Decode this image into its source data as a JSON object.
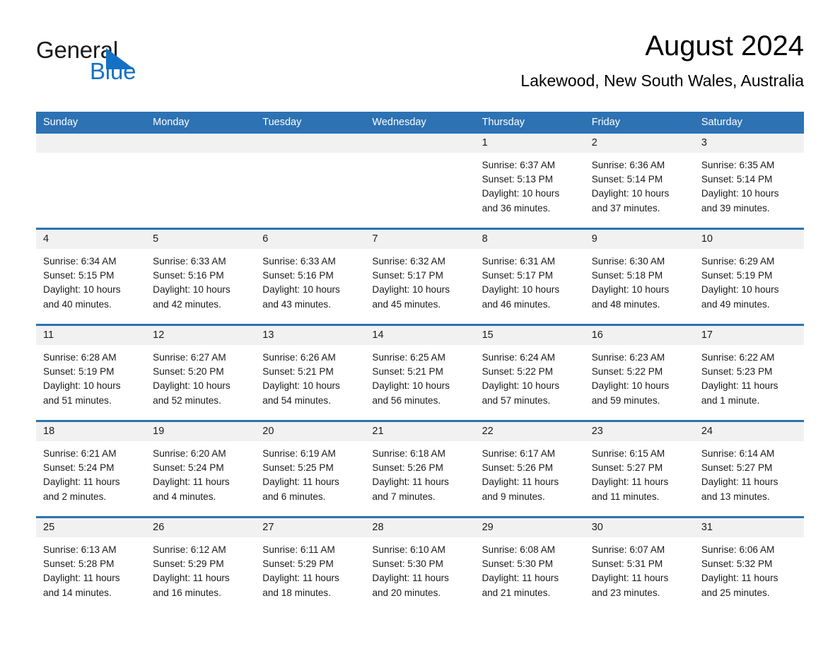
{
  "brand": {
    "name_part1": "General",
    "name_part2": "Blue",
    "triangle_color": "#1571c4",
    "blue_text_color": "#1571c4"
  },
  "header": {
    "month_title": "August 2024",
    "location": "Lakewood, New South Wales, Australia"
  },
  "theme": {
    "header_blue": "#2d72b3",
    "daynum_band": "#f1f1f1",
    "cell_background": "#ffffff",
    "text_color": "#1a1a1a"
  },
  "weekday_headers": [
    "Sunday",
    "Monday",
    "Tuesday",
    "Wednesday",
    "Thursday",
    "Friday",
    "Saturday"
  ],
  "weeks": [
    {
      "cells": [
        {
          "day": "",
          "info": ""
        },
        {
          "day": "",
          "info": ""
        },
        {
          "day": "",
          "info": ""
        },
        {
          "day": "",
          "info": ""
        },
        {
          "day": "1",
          "info": "Sunrise: 6:37 AM\nSunset: 5:13 PM\nDaylight: 10 hours\nand 36 minutes."
        },
        {
          "day": "2",
          "info": "Sunrise: 6:36 AM\nSunset: 5:14 PM\nDaylight: 10 hours\nand 37 minutes."
        },
        {
          "day": "3",
          "info": "Sunrise: 6:35 AM\nSunset: 5:14 PM\nDaylight: 10 hours\nand 39 minutes."
        }
      ]
    },
    {
      "cells": [
        {
          "day": "4",
          "info": "Sunrise: 6:34 AM\nSunset: 5:15 PM\nDaylight: 10 hours\nand 40 minutes."
        },
        {
          "day": "5",
          "info": "Sunrise: 6:33 AM\nSunset: 5:16 PM\nDaylight: 10 hours\nand 42 minutes."
        },
        {
          "day": "6",
          "info": "Sunrise: 6:33 AM\nSunset: 5:16 PM\nDaylight: 10 hours\nand 43 minutes."
        },
        {
          "day": "7",
          "info": "Sunrise: 6:32 AM\nSunset: 5:17 PM\nDaylight: 10 hours\nand 45 minutes."
        },
        {
          "day": "8",
          "info": "Sunrise: 6:31 AM\nSunset: 5:17 PM\nDaylight: 10 hours\nand 46 minutes."
        },
        {
          "day": "9",
          "info": "Sunrise: 6:30 AM\nSunset: 5:18 PM\nDaylight: 10 hours\nand 48 minutes."
        },
        {
          "day": "10",
          "info": "Sunrise: 6:29 AM\nSunset: 5:19 PM\nDaylight: 10 hours\nand 49 minutes."
        }
      ]
    },
    {
      "cells": [
        {
          "day": "11",
          "info": "Sunrise: 6:28 AM\nSunset: 5:19 PM\nDaylight: 10 hours\nand 51 minutes."
        },
        {
          "day": "12",
          "info": "Sunrise: 6:27 AM\nSunset: 5:20 PM\nDaylight: 10 hours\nand 52 minutes."
        },
        {
          "day": "13",
          "info": "Sunrise: 6:26 AM\nSunset: 5:21 PM\nDaylight: 10 hours\nand 54 minutes."
        },
        {
          "day": "14",
          "info": "Sunrise: 6:25 AM\nSunset: 5:21 PM\nDaylight: 10 hours\nand 56 minutes."
        },
        {
          "day": "15",
          "info": "Sunrise: 6:24 AM\nSunset: 5:22 PM\nDaylight: 10 hours\nand 57 minutes."
        },
        {
          "day": "16",
          "info": "Sunrise: 6:23 AM\nSunset: 5:22 PM\nDaylight: 10 hours\nand 59 minutes."
        },
        {
          "day": "17",
          "info": "Sunrise: 6:22 AM\nSunset: 5:23 PM\nDaylight: 11 hours\nand 1 minute."
        }
      ]
    },
    {
      "cells": [
        {
          "day": "18",
          "info": "Sunrise: 6:21 AM\nSunset: 5:24 PM\nDaylight: 11 hours\nand 2 minutes."
        },
        {
          "day": "19",
          "info": "Sunrise: 6:20 AM\nSunset: 5:24 PM\nDaylight: 11 hours\nand 4 minutes."
        },
        {
          "day": "20",
          "info": "Sunrise: 6:19 AM\nSunset: 5:25 PM\nDaylight: 11 hours\nand 6 minutes."
        },
        {
          "day": "21",
          "info": "Sunrise: 6:18 AM\nSunset: 5:26 PM\nDaylight: 11 hours\nand 7 minutes."
        },
        {
          "day": "22",
          "info": "Sunrise: 6:17 AM\nSunset: 5:26 PM\nDaylight: 11 hours\nand 9 minutes."
        },
        {
          "day": "23",
          "info": "Sunrise: 6:15 AM\nSunset: 5:27 PM\nDaylight: 11 hours\nand 11 minutes."
        },
        {
          "day": "24",
          "info": "Sunrise: 6:14 AM\nSunset: 5:27 PM\nDaylight: 11 hours\nand 13 minutes."
        }
      ]
    },
    {
      "cells": [
        {
          "day": "25",
          "info": "Sunrise: 6:13 AM\nSunset: 5:28 PM\nDaylight: 11 hours\nand 14 minutes."
        },
        {
          "day": "26",
          "info": "Sunrise: 6:12 AM\nSunset: 5:29 PM\nDaylight: 11 hours\nand 16 minutes."
        },
        {
          "day": "27",
          "info": "Sunrise: 6:11 AM\nSunset: 5:29 PM\nDaylight: 11 hours\nand 18 minutes."
        },
        {
          "day": "28",
          "info": "Sunrise: 6:10 AM\nSunset: 5:30 PM\nDaylight: 11 hours\nand 20 minutes."
        },
        {
          "day": "29",
          "info": "Sunrise: 6:08 AM\nSunset: 5:30 PM\nDaylight: 11 hours\nand 21 minutes."
        },
        {
          "day": "30",
          "info": "Sunrise: 6:07 AM\nSunset: 5:31 PM\nDaylight: 11 hours\nand 23 minutes."
        },
        {
          "day": "31",
          "info": "Sunrise: 6:06 AM\nSunset: 5:32 PM\nDaylight: 11 hours\nand 25 minutes."
        }
      ]
    }
  ]
}
